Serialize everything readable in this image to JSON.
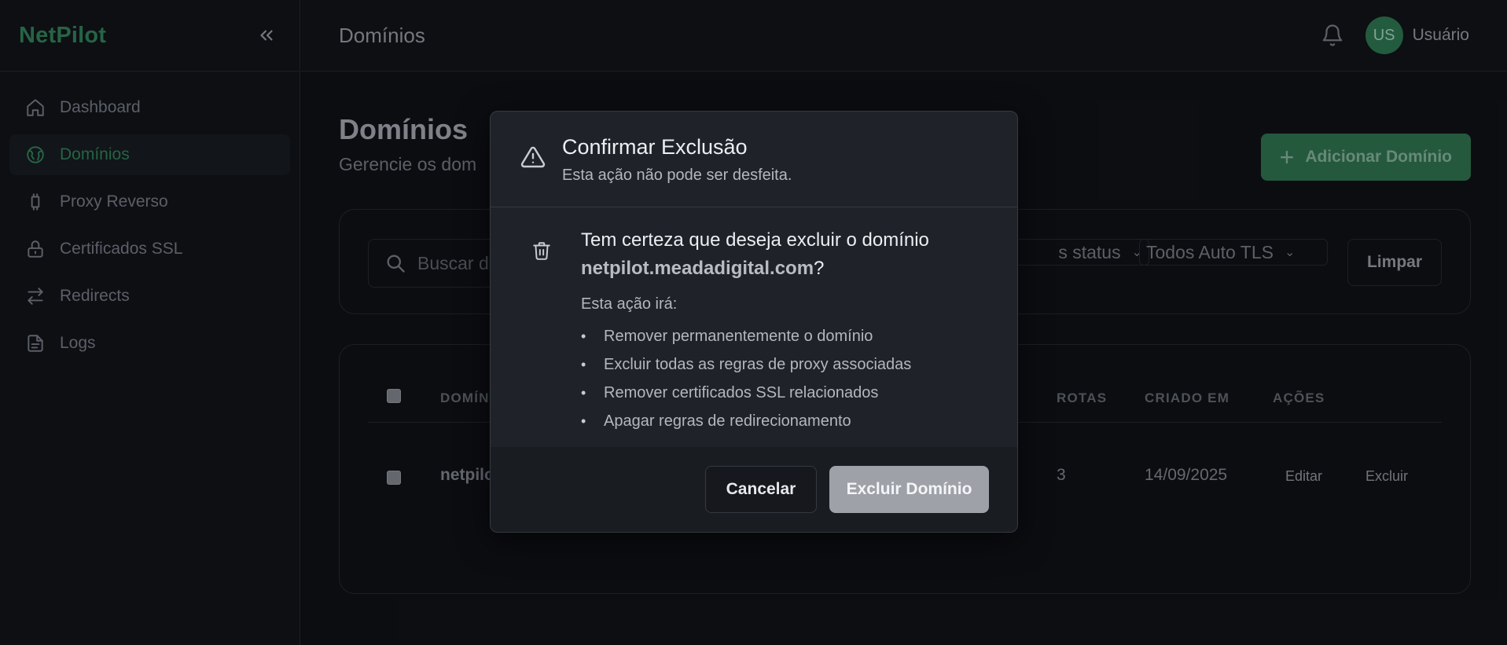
{
  "app": {
    "brand": "NetPilot",
    "accent": "#2f7a55"
  },
  "sidebar": {
    "items": [
      {
        "label": "Dashboard",
        "icon": "home-icon"
      },
      {
        "label": "Domínios",
        "icon": "globe-icon",
        "active": true
      },
      {
        "label": "Proxy Reverso",
        "icon": "proxy-icon"
      },
      {
        "label": "Certificados SSL",
        "icon": "lock-icon"
      },
      {
        "label": "Redirects",
        "icon": "arrows-icon"
      },
      {
        "label": "Logs",
        "icon": "file-icon"
      }
    ]
  },
  "header": {
    "title": "Domínios",
    "avatar_initials": "US",
    "username": "Usuário"
  },
  "main": {
    "title": "Domínios",
    "subtitle": "Gerencie os dom",
    "add_button": "Adicionar Domínio",
    "filters": {
      "search_placeholder": "Buscar d",
      "status_select": "s status",
      "tls_select": "Todos Auto TLS",
      "clear_button": "Limpar"
    },
    "table": {
      "columns": [
        "DOMÍN",
        "ROTAS",
        "CRIADO EM",
        "AÇÕES"
      ],
      "rows": [
        {
          "domain": "netpilo",
          "routes": "3",
          "created": "14/09/2025",
          "edit": "Editar",
          "delete": "Excluir"
        }
      ]
    }
  },
  "modal": {
    "title": "Confirmar Exclusão",
    "subtitle": "Esta ação não pode ser desfeita.",
    "question_prefix": "Tem certeza que deseja excluir o domínio",
    "domain": "netpilot.meadadigital.com",
    "question_suffix": "?",
    "will_label": "Esta ação irá:",
    "consequences": [
      "Remover permanentemente o domínio",
      "Excluir todas as regras de proxy associadas",
      "Remover certificados SSL relacionados",
      "Apagar regras de redirecionamento"
    ],
    "cancel_button": "Cancelar",
    "confirm_button": "Excluir Domínio"
  }
}
